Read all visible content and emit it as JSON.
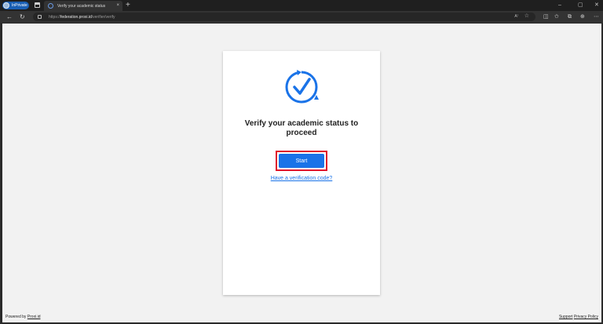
{
  "browser": {
    "inprivate_label": "InPrivate",
    "tab": {
      "title": "Verify your academic status",
      "close": "×"
    },
    "new_tab": "+",
    "url": {
      "scheme": "https://",
      "host": "federation.proxi.id",
      "path": "/verifier/verify"
    },
    "nav": {
      "back": "←",
      "refresh": "↻"
    },
    "read_aloud": "A⁾",
    "window": {
      "minimize": "–",
      "maximize": "▢",
      "close": "✕"
    }
  },
  "page": {
    "heading": "Verify your academic status to proceed",
    "start_button": "Start",
    "verification_link": "Have a verification code?",
    "footer": {
      "powered_prefix": "Powered by ",
      "powered_link": "Proxi.id",
      "support": "Support",
      "privacy": "Privacy Policy"
    }
  },
  "colors": {
    "accent": "#1a73e8",
    "highlight": "#e0142b"
  }
}
